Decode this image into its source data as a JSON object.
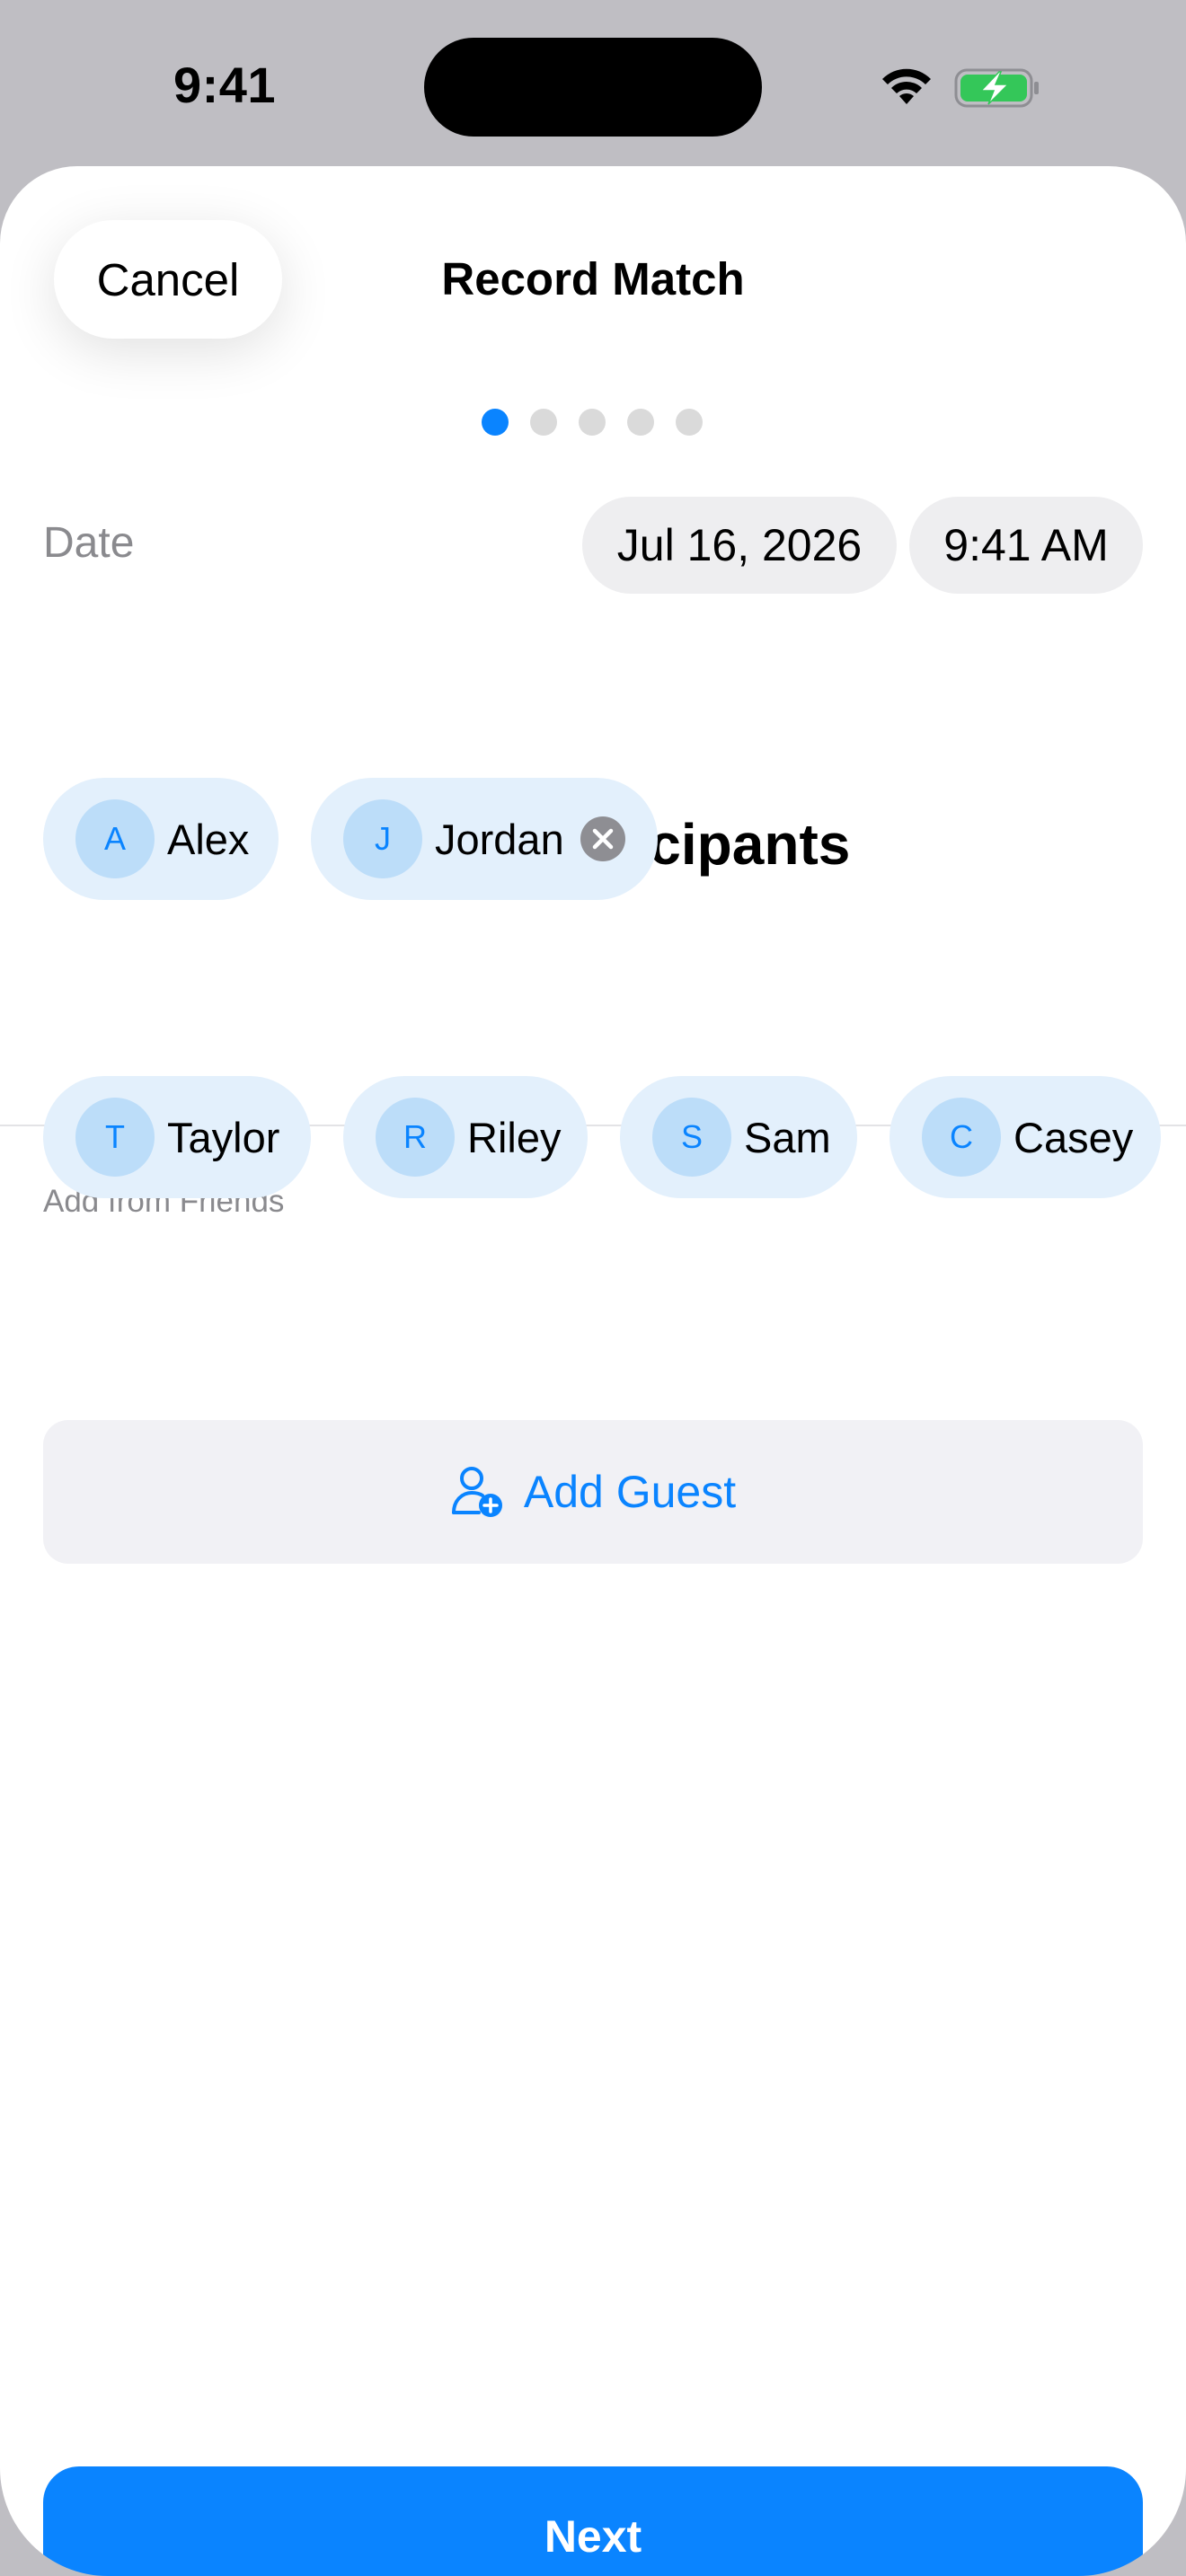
{
  "status_bar": {
    "time": "9:41",
    "icons": [
      "wifi-icon",
      "battery-charging-icon"
    ],
    "battery_color": "#34C759"
  },
  "header": {
    "cancel_label": "Cancel",
    "title": "Record Match"
  },
  "progress": {
    "total_steps": 5,
    "current_step": 1
  },
  "date_row": {
    "label": "Date",
    "date": "Jul 16, 2026",
    "time": "9:41 AM"
  },
  "participants": {
    "title": "Select Participants",
    "selected": [
      {
        "initial": "A",
        "name": "Alex",
        "removable": false
      },
      {
        "initial": "J",
        "name": "Jordan",
        "removable": true
      }
    ]
  },
  "friends": {
    "label": "Add from Friends",
    "items": [
      {
        "initial": "T",
        "name": "Taylor"
      },
      {
        "initial": "R",
        "name": "Riley"
      },
      {
        "initial": "S",
        "name": "Sam"
      },
      {
        "initial": "C",
        "name": "Casey"
      }
    ]
  },
  "add_guest": {
    "label": "Add Guest",
    "icon": "person-add-icon"
  },
  "footer": {
    "next_label": "Next"
  },
  "colors": {
    "accent": "#0A84FF",
    "chip_background": "#E3F0FC",
    "avatar_background": "#BCDDF9",
    "backdrop": "#BFBEC3"
  }
}
